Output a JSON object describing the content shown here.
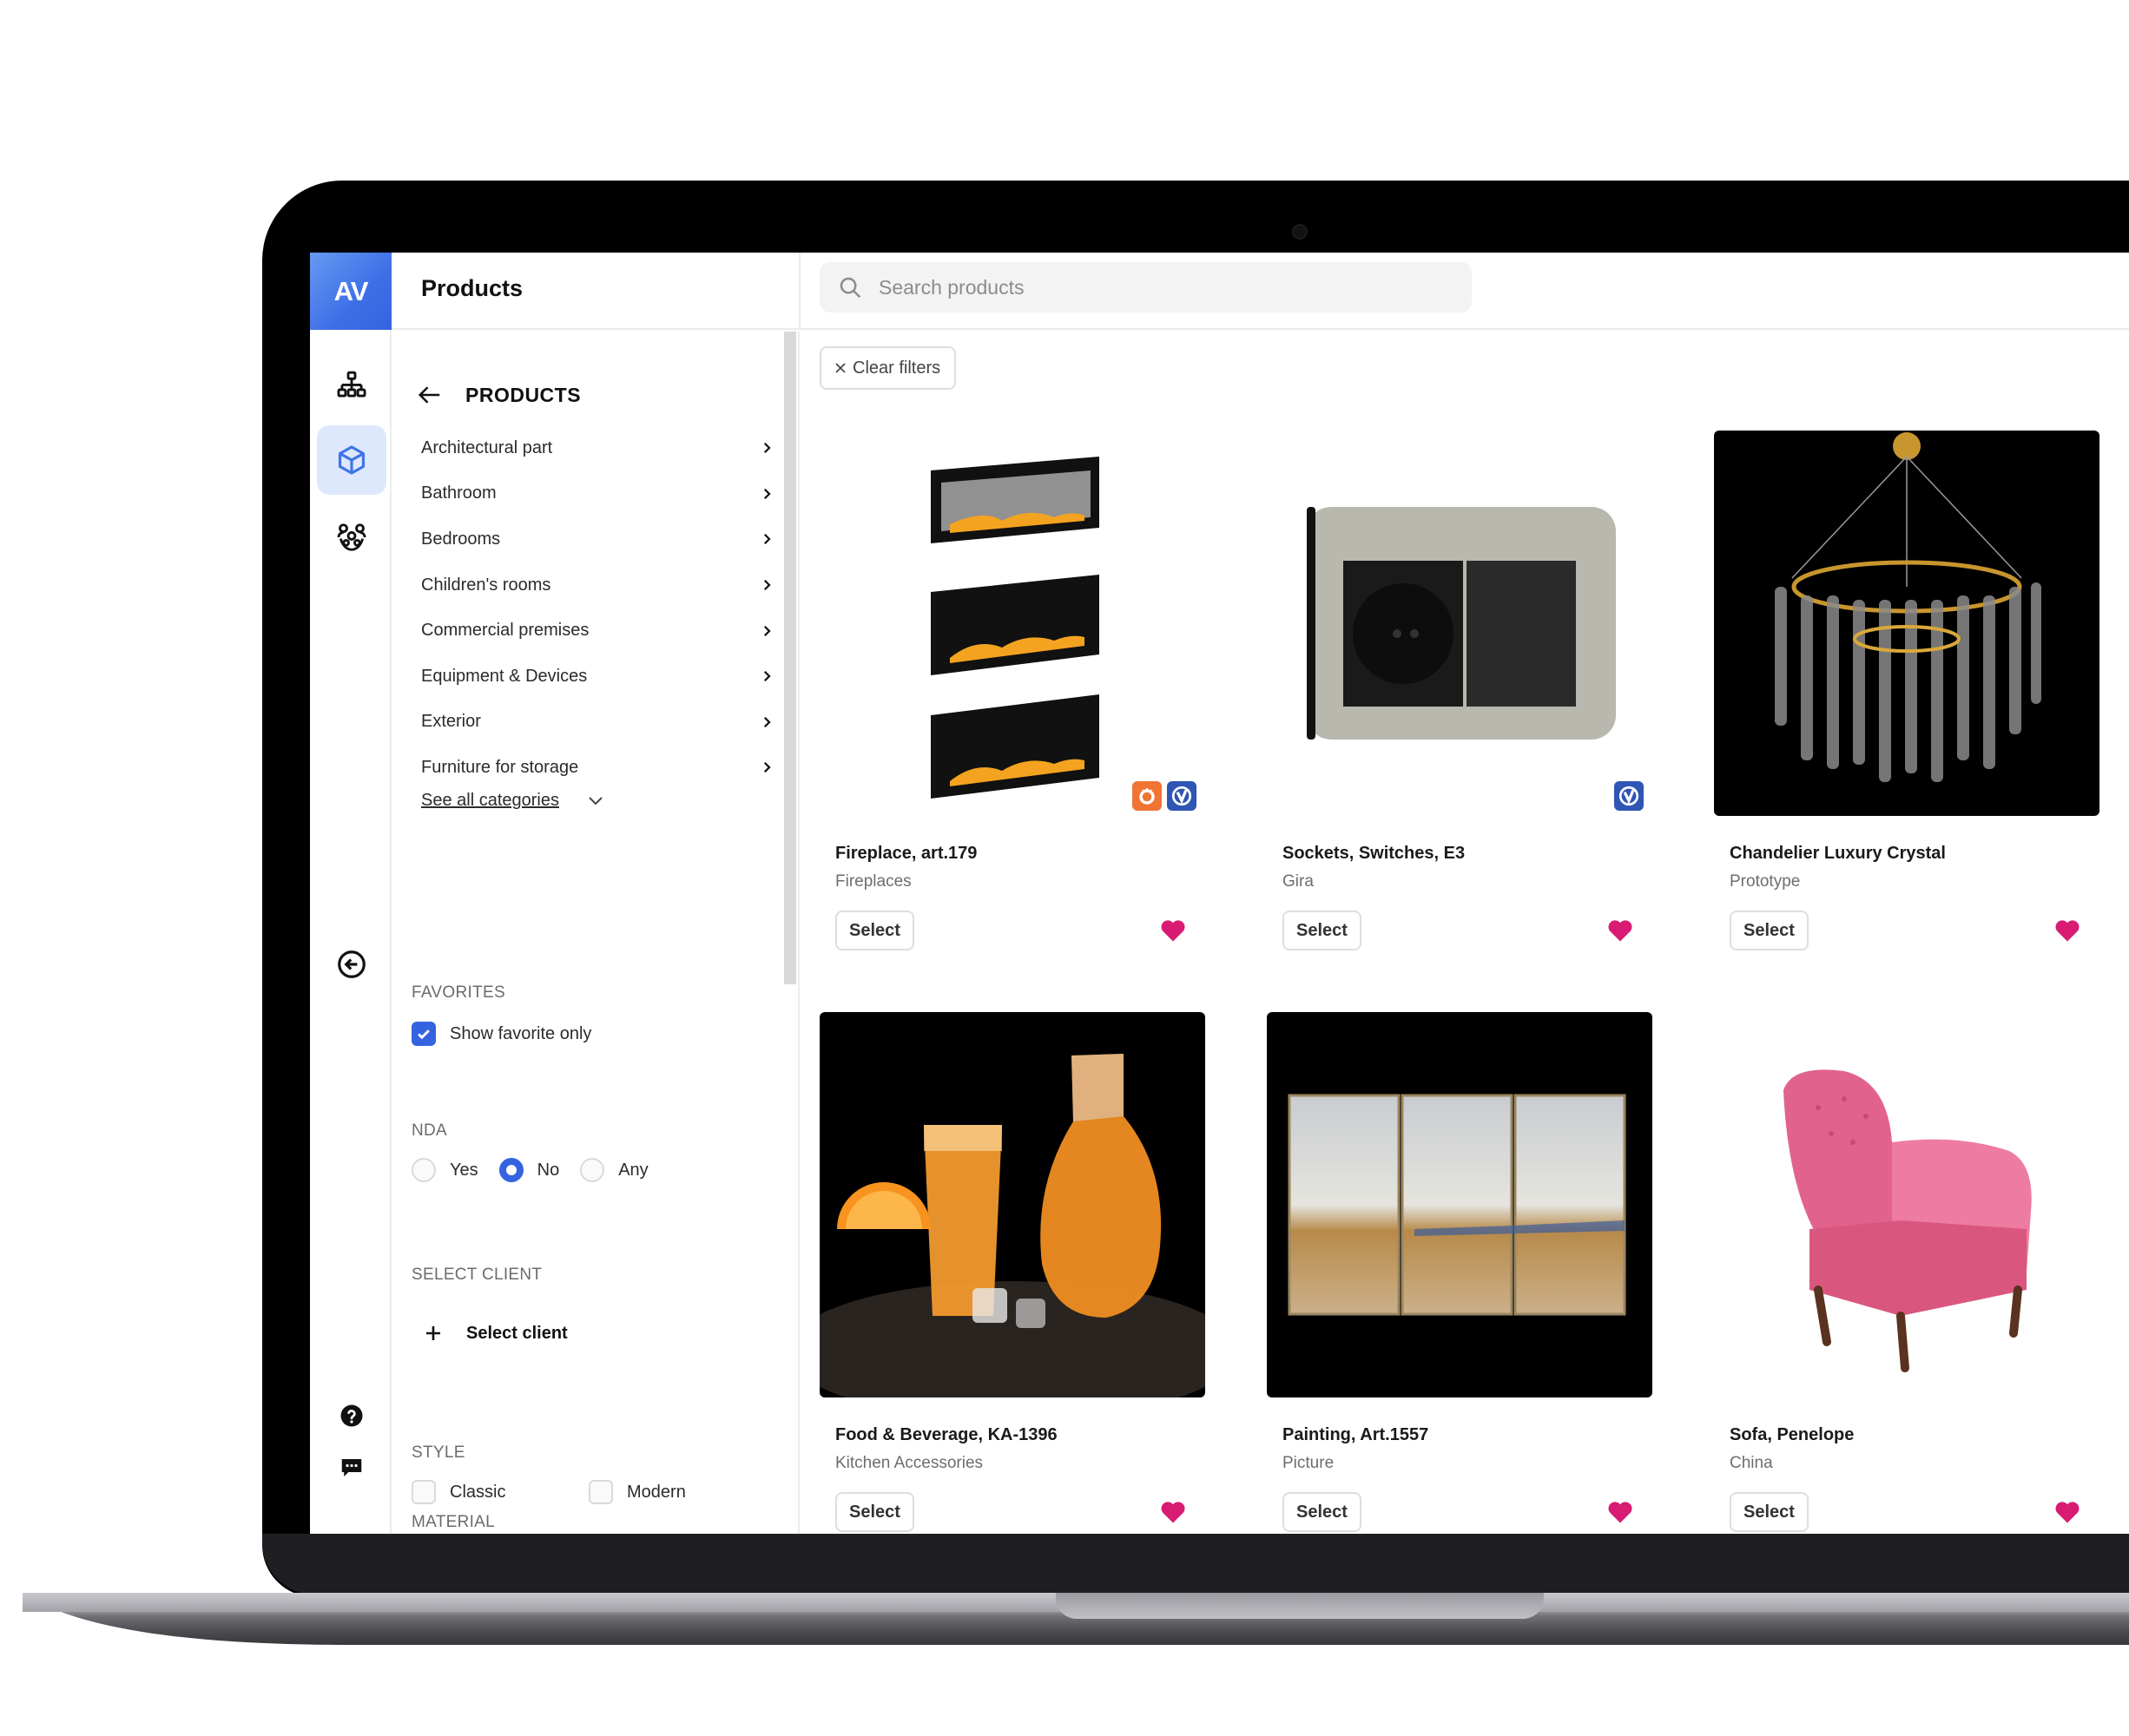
{
  "app": {
    "logo_text": "AV",
    "page_title": "Products",
    "accent_color": "#3563e0",
    "favorite_color": "#d81b73"
  },
  "search": {
    "placeholder": "Search products",
    "value": ""
  },
  "rail": {
    "items": [
      {
        "icon": "sitemap-icon",
        "active": false
      },
      {
        "icon": "cube-icon",
        "active": true
      },
      {
        "icon": "team-icon",
        "active": false
      }
    ],
    "collapse_icon": "circle-arrow-left-icon",
    "bottom_icons": [
      "help-icon",
      "chat-icon"
    ]
  },
  "categories": {
    "heading": "PRODUCTS",
    "items": [
      {
        "label": "Architectural part"
      },
      {
        "label": "Bathroom"
      },
      {
        "label": "Bedrooms"
      },
      {
        "label": "Children's rooms"
      },
      {
        "label": "Commercial premises"
      },
      {
        "label": "Equipment & Devices"
      },
      {
        "label": "Exterior"
      },
      {
        "label": "Furniture for storage"
      }
    ],
    "see_all_label": "See all categories"
  },
  "filters": {
    "favorites": {
      "label": "FAVORITES",
      "option_label": "Show favorite only",
      "checked": true
    },
    "nda": {
      "label": "NDA",
      "options": [
        "Yes",
        "No",
        "Any"
      ],
      "selected": "No"
    },
    "client": {
      "label": "SELECT CLIENT",
      "button_label": "Select client"
    },
    "style": {
      "label": "STYLE",
      "options": [
        {
          "label": "Classic",
          "checked": false
        },
        {
          "label": "Modern",
          "checked": false
        }
      ]
    },
    "material": {
      "label": "MATERIAL"
    }
  },
  "toolbar": {
    "clear_filters_label": "Clear filters"
  },
  "products": [
    {
      "name": "Fireplace, art.179",
      "category": "Fireplaces",
      "select_label": "Select",
      "favorite": true,
      "badges": [
        "corona-render-badge",
        "vray-badge"
      ],
      "image": "fireplace"
    },
    {
      "name": "Sockets, Switches, E3",
      "category": "Gira",
      "select_label": "Select",
      "favorite": true,
      "badges": [
        "vray-badge"
      ],
      "image": "socket"
    },
    {
      "name": "Chandelier Luxury Crystal",
      "category": "Prototype",
      "select_label": "Select",
      "favorite": true,
      "badges": [],
      "image": "chandelier"
    },
    {
      "name": "Food & Beverage, KA-1396",
      "category": "Kitchen Accessories",
      "select_label": "Select",
      "favorite": true,
      "badges": [],
      "image": "drinks"
    },
    {
      "name": "Painting, Art.1557",
      "category": "Picture",
      "select_label": "Select",
      "favorite": true,
      "badges": [],
      "image": "painting"
    },
    {
      "name": "Sofa, Penelope",
      "category": "China",
      "select_label": "Select",
      "favorite": true,
      "badges": [],
      "image": "armchair"
    }
  ]
}
